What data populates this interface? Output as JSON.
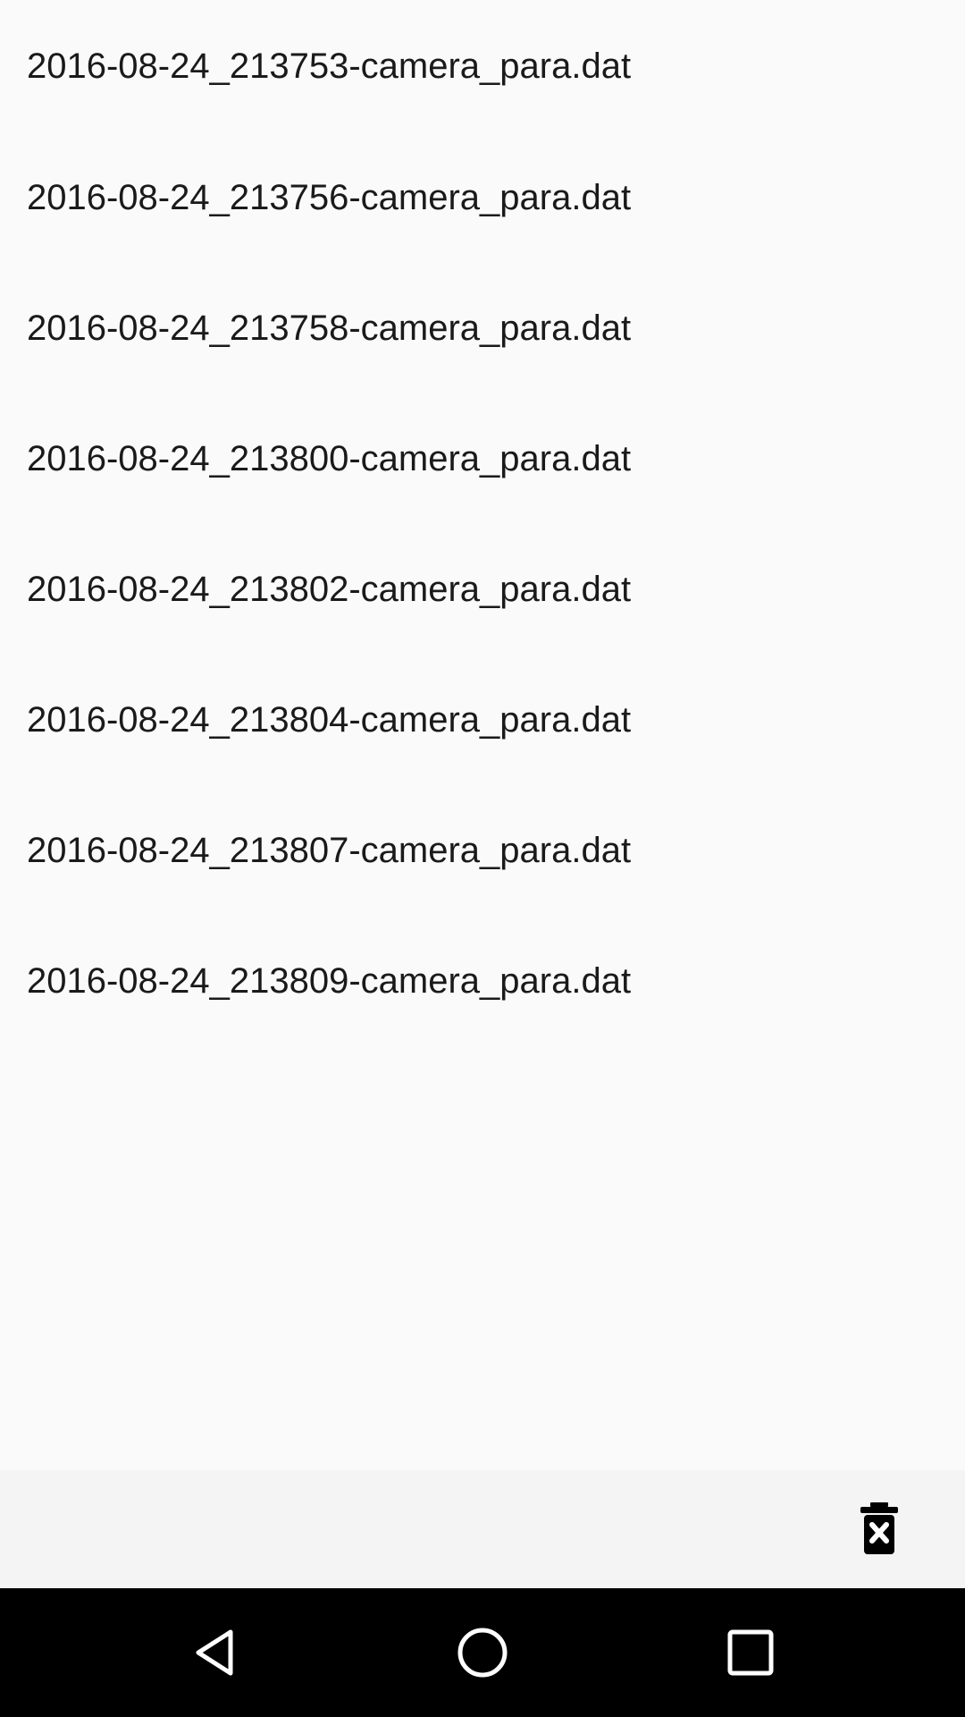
{
  "files": [
    {
      "name": "2016-08-24_213753-camera_para.dat"
    },
    {
      "name": "2016-08-24_213756-camera_para.dat"
    },
    {
      "name": "2016-08-24_213758-camera_para.dat"
    },
    {
      "name": "2016-08-24_213800-camera_para.dat"
    },
    {
      "name": "2016-08-24_213802-camera_para.dat"
    },
    {
      "name": "2016-08-24_213804-camera_para.dat"
    },
    {
      "name": "2016-08-24_213807-camera_para.dat"
    },
    {
      "name": "2016-08-24_213809-camera_para.dat"
    }
  ],
  "toolbar": {
    "delete_icon": "delete-forever-icon"
  },
  "navigation": {
    "back_icon": "back-triangle-icon",
    "home_icon": "home-circle-icon",
    "recents_icon": "recents-square-icon"
  },
  "colors": {
    "background": "#fafafa",
    "text": "#1a1a1a",
    "bottom_bar": "#f4f4f4",
    "nav_bar": "#000000",
    "icon_dark": "#000000",
    "icon_light": "#ffffff"
  }
}
